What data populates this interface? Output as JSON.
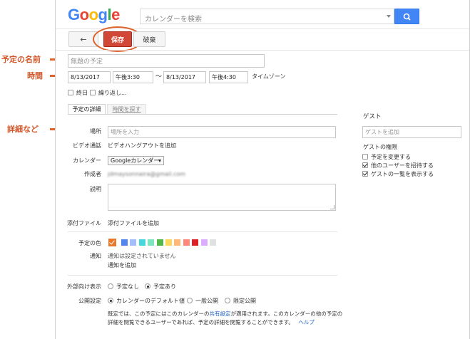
{
  "annotations": {
    "event_name": "予定の名前",
    "datetime": "時間",
    "details": "詳細など"
  },
  "header": {
    "logo": "Google",
    "search_placeholder": "カレンダーを検索"
  },
  "toolbar": {
    "back_glyph": "←",
    "save_label": "保存",
    "discard_label": "破棄"
  },
  "event": {
    "title_placeholder": "無題の予定",
    "start_date": "8/13/2017",
    "start_time": "午後3:30",
    "separator": "～",
    "end_date": "8/13/2017",
    "end_time": "午後4:30",
    "timezone_link": "タイムゾーン",
    "all_day_label": "終日",
    "repeat_label": "繰り返し..."
  },
  "tabs": {
    "details": "予定の詳細",
    "find_time": "時間を探す"
  },
  "form": {
    "location_label": "場所",
    "location_placeholder": "場所を入力",
    "video_label": "ビデオ通話",
    "video_link": "ビデオハングアウトを追加",
    "calendar_label": "カレンダー",
    "calendar_value": "Googleカレンダー",
    "creator_label": "作成者",
    "creator_value": "jdmaysonnaira@gmail.com",
    "description_label": "説明",
    "attachment_label": "添付ファイル",
    "attachment_link": "添付ファイルを追加",
    "color_label": "予定の色",
    "notification_label": "通知",
    "notification_text": "通知は設定されていません",
    "notification_link": "通知を追加",
    "visibility_out_label": "外部向け表示",
    "visibility_out_options": [
      "予定なし",
      "予定あり"
    ],
    "privacy_label": "公開設定",
    "privacy_options": [
      "カレンダーのデフォルト値",
      "一般公開",
      "限定公開"
    ],
    "footnote_line1_pre": "既定では、この予定にはこのカレンダーの",
    "footnote_line1_link": "共有設定",
    "footnote_line1_post": "が適用されます。このカレンダーの他の予定の",
    "footnote_line2": "詳細を閲覧できるユーザーであれば、予定の詳細を閲覧することができます。",
    "footnote_help": "ヘルプ"
  },
  "colors": {
    "selected": "#e8782a",
    "swatches": [
      "#5484ed",
      "#a4bdfc",
      "#46d6db",
      "#7ae7bf",
      "#51b749",
      "#fbd75b",
      "#ffb878",
      "#ff887c",
      "#dc2127",
      "#dbadff",
      "#e1e1e1"
    ],
    "accent_link": "#1a5dc9",
    "save_button": "#d14836",
    "annotation": "#e0622a"
  },
  "guests": {
    "heading": "ゲスト",
    "input_placeholder": "ゲストを追加",
    "permissions_heading": "ゲストの権限",
    "permissions": [
      {
        "label": "予定を変更する",
        "checked": false
      },
      {
        "label": "他のユーザーを招待する",
        "checked": true
      },
      {
        "label": "ゲストの一覧を表示する",
        "checked": true
      }
    ]
  }
}
